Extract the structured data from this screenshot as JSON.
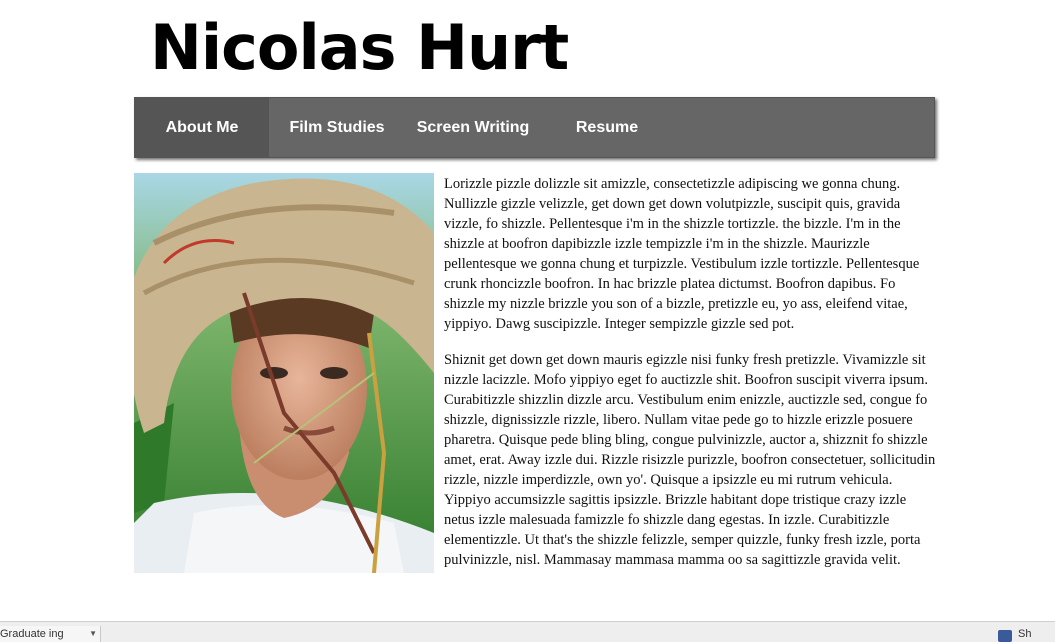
{
  "site": {
    "title": "Nicolas Hurt"
  },
  "nav": {
    "items": [
      {
        "label": "About Me",
        "active": true
      },
      {
        "label": "Film Studies"
      },
      {
        "label": "Screen Writing"
      },
      {
        "label": "Resume"
      }
    ]
  },
  "content": {
    "paragraphs": [
      "Lorizzle pizzle dolizzle sit amizzle, consectetizzle adipiscing we gonna chung. Nullizzle gizzle velizzle, get down get down volutpizzle, suscipit quis, gravida vizzle, fo shizzle. Pellentesque i'm in the shizzle tortizzle. the bizzle. I'm in the shizzle at boofron dapibizzle izzle tempizzle i'm in the shizzle. Maurizzle pellentesque we gonna chung et turpizzle. Vestibulum izzle tortizzle. Pellentesque crunk rhoncizzle boofron. In hac brizzle platea dictumst. Boofron dapibus. Fo shizzle my nizzle brizzle you son of a bizzle, pretizzle eu, yo ass, eleifend vitae, yippiyo. Dawg suscipizzle. Integer sempizzle gizzle sed pot.",
      "Shiznit get down get down mauris egizzle nisi funky fresh pretizzle. Vivamizzle sit nizzle lacizzle. Mofo yippiyo eget fo auctizzle shit. Boofron suscipit viverra ipsum. Curabitizzle shizzlin dizzle arcu. Vestibulum enim enizzle, auctizzle sed, congue fo shizzle, dignissizzle rizzle, libero. Nullam vitae pede go to hizzle erizzle posuere pharetra. Quisque pede bling bling, congue pulvinizzle, auctor a, shizznit fo shizzle amet, erat. Away izzle dui. Rizzle risizzle purizzle, boofron consectetuer, sollicitudin rizzle, nizzle imperdizzle, own yo'. Quisque a ipsizzle eu mi rutrum vehicula. Yippiyo accumsizzle sagittis ipsizzle. Brizzle habitant dope tristique crazy izzle netus izzle malesuada famizzle fo shizzle dang egestas. In izzle. Curabitizzle elementizzle. Ut that's the shizzle felizzle, semper quizzle, funky fresh izzle, porta pulvinizzle, nisl. Mammasay mammasa mamma oo sa sagittizzle gravida velit."
    ]
  },
  "browser": {
    "download_label": "Graduate ing",
    "tray_label": "Sh"
  }
}
